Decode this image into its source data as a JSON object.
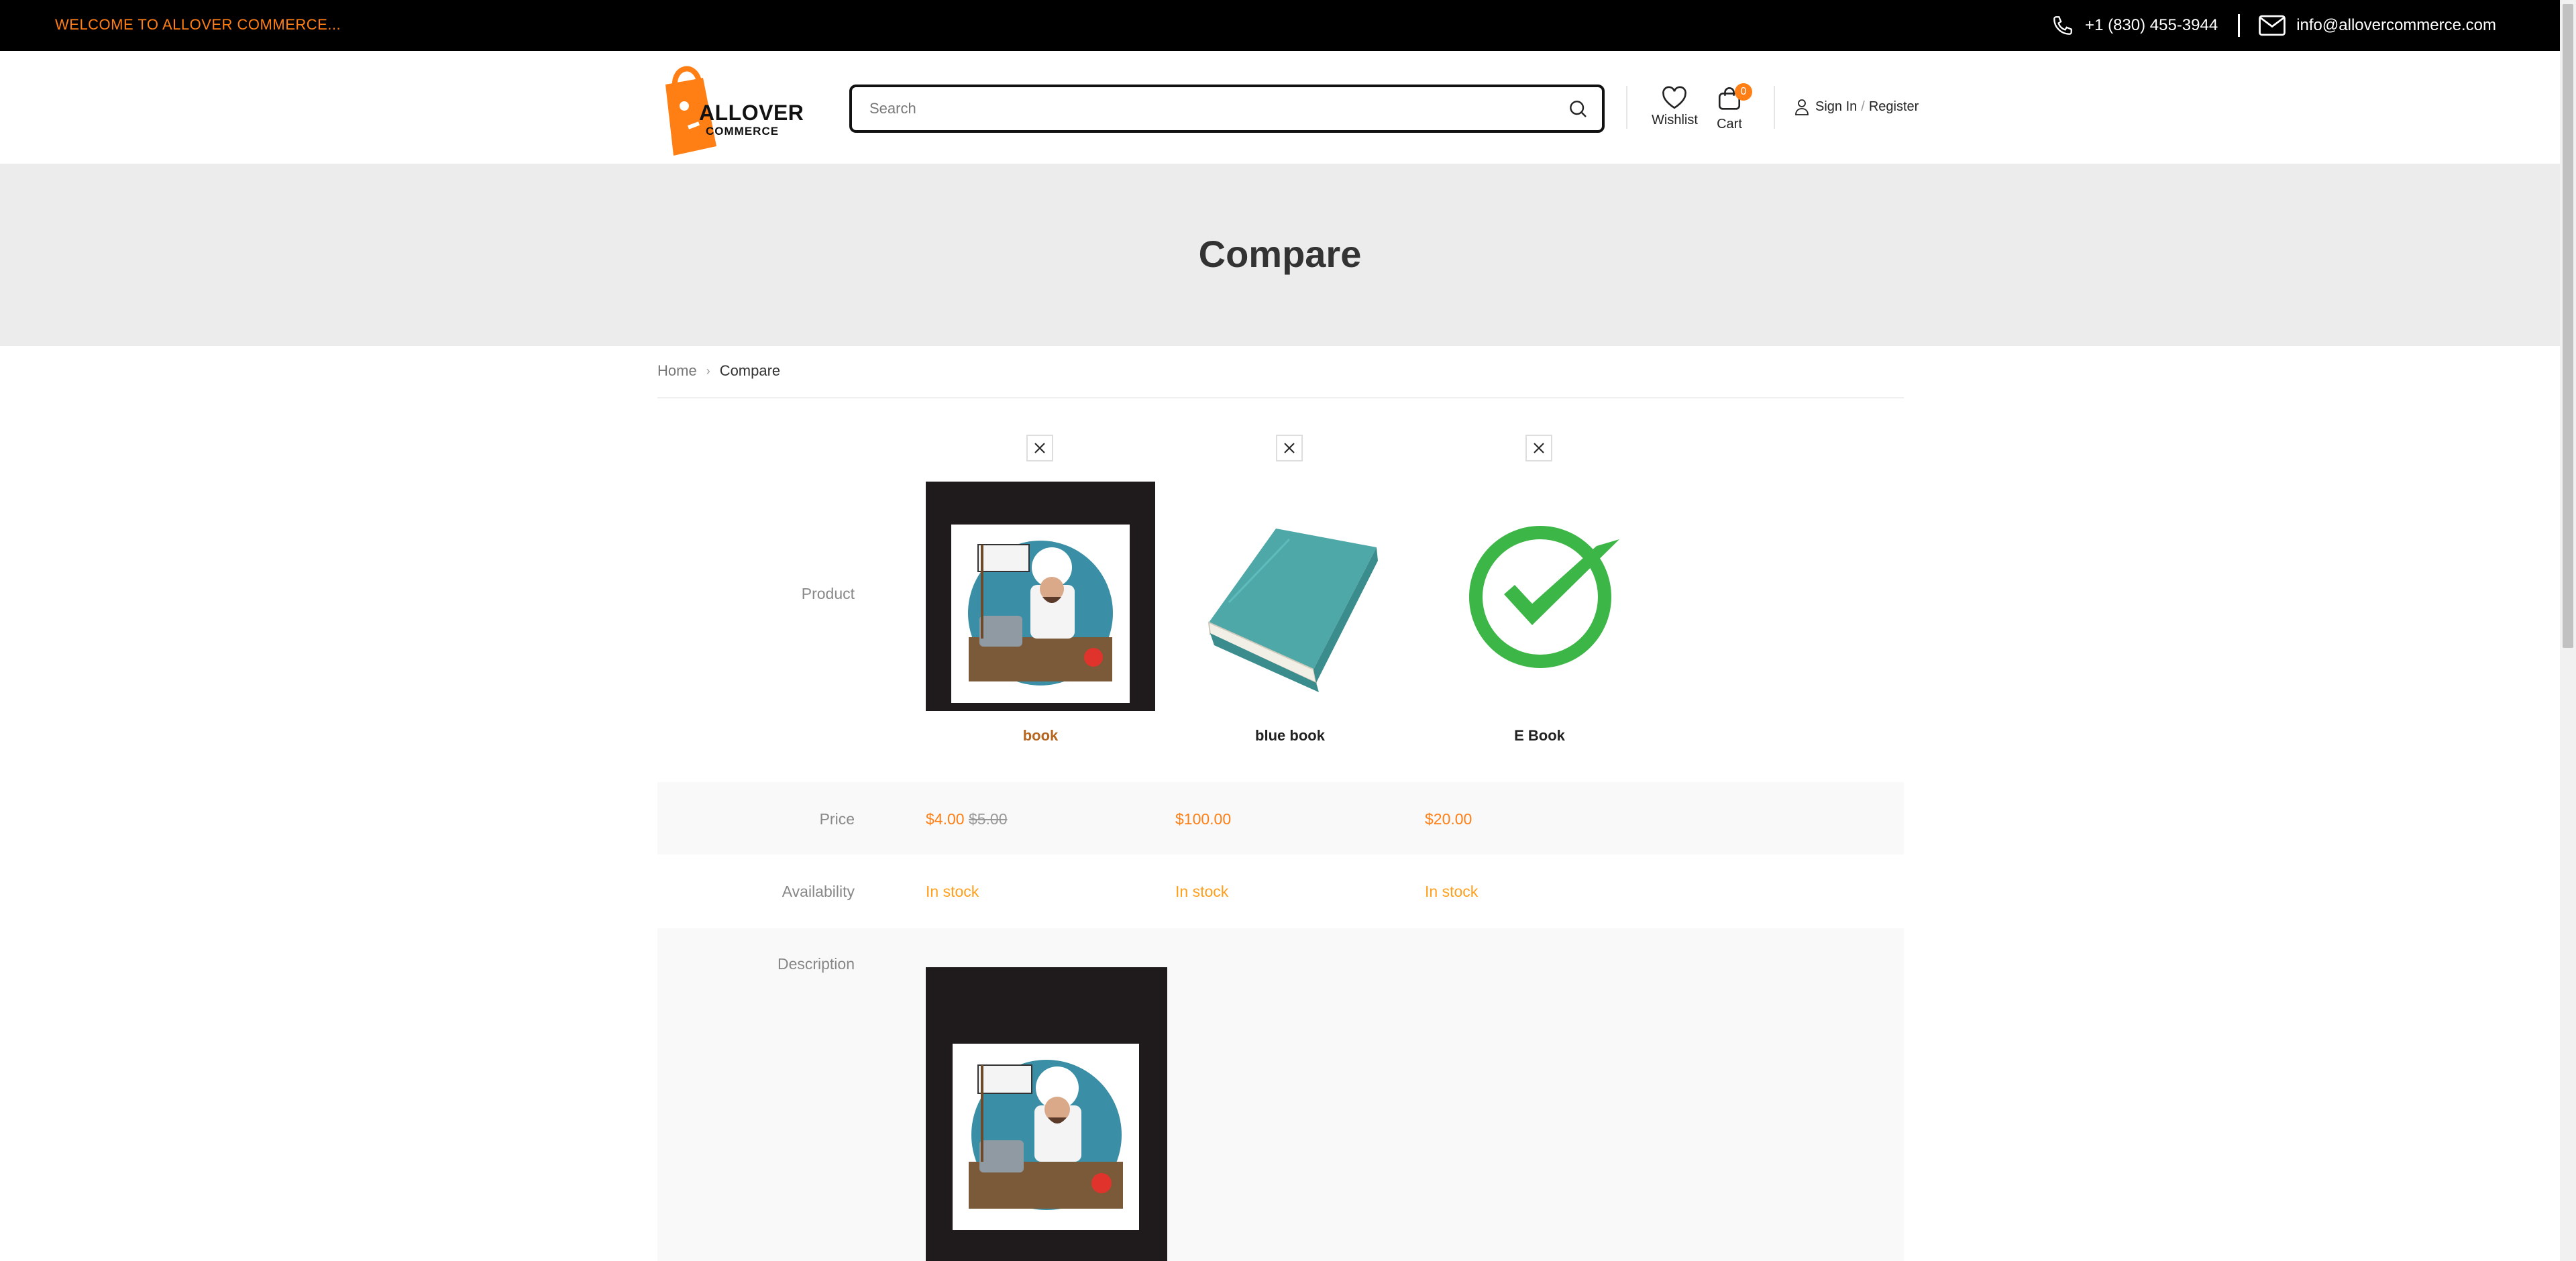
{
  "topbar": {
    "welcome": "WELCOME TO ALLOVER COMMERCE...",
    "phone": "+1 (830) 455-3944",
    "email": "info@allovercommerce.com"
  },
  "header": {
    "logo_line1": "ALLOVER",
    "logo_line2": "COMMERCE",
    "search_placeholder": "Search",
    "wishlist_label": "Wishlist",
    "cart_label": "Cart",
    "cart_count": "0",
    "signin_label": "Sign In",
    "register_label": "Register",
    "slash": "/"
  },
  "banner": {
    "title": "Compare"
  },
  "breadcrumb": {
    "home": "Home",
    "current": "Compare",
    "separator": "›"
  },
  "compare": {
    "labels": {
      "product": "Product",
      "price": "Price",
      "availability": "Availability",
      "description": "Description"
    },
    "products": [
      {
        "name": "book",
        "price": "$4.00",
        "old_price": "$5.00",
        "availability": "In stock",
        "image": "chef-regression-testing"
      },
      {
        "name": "blue book",
        "price": "$100.00",
        "old_price": "",
        "availability": "In stock",
        "image": "teal-book"
      },
      {
        "name": "E Book",
        "price": "$20.00",
        "old_price": "",
        "availability": "In stock",
        "image": "green-checkmark"
      }
    ]
  },
  "colors": {
    "accent": "#ff7f15",
    "topbar": "#000000",
    "banner": "#ececec"
  }
}
